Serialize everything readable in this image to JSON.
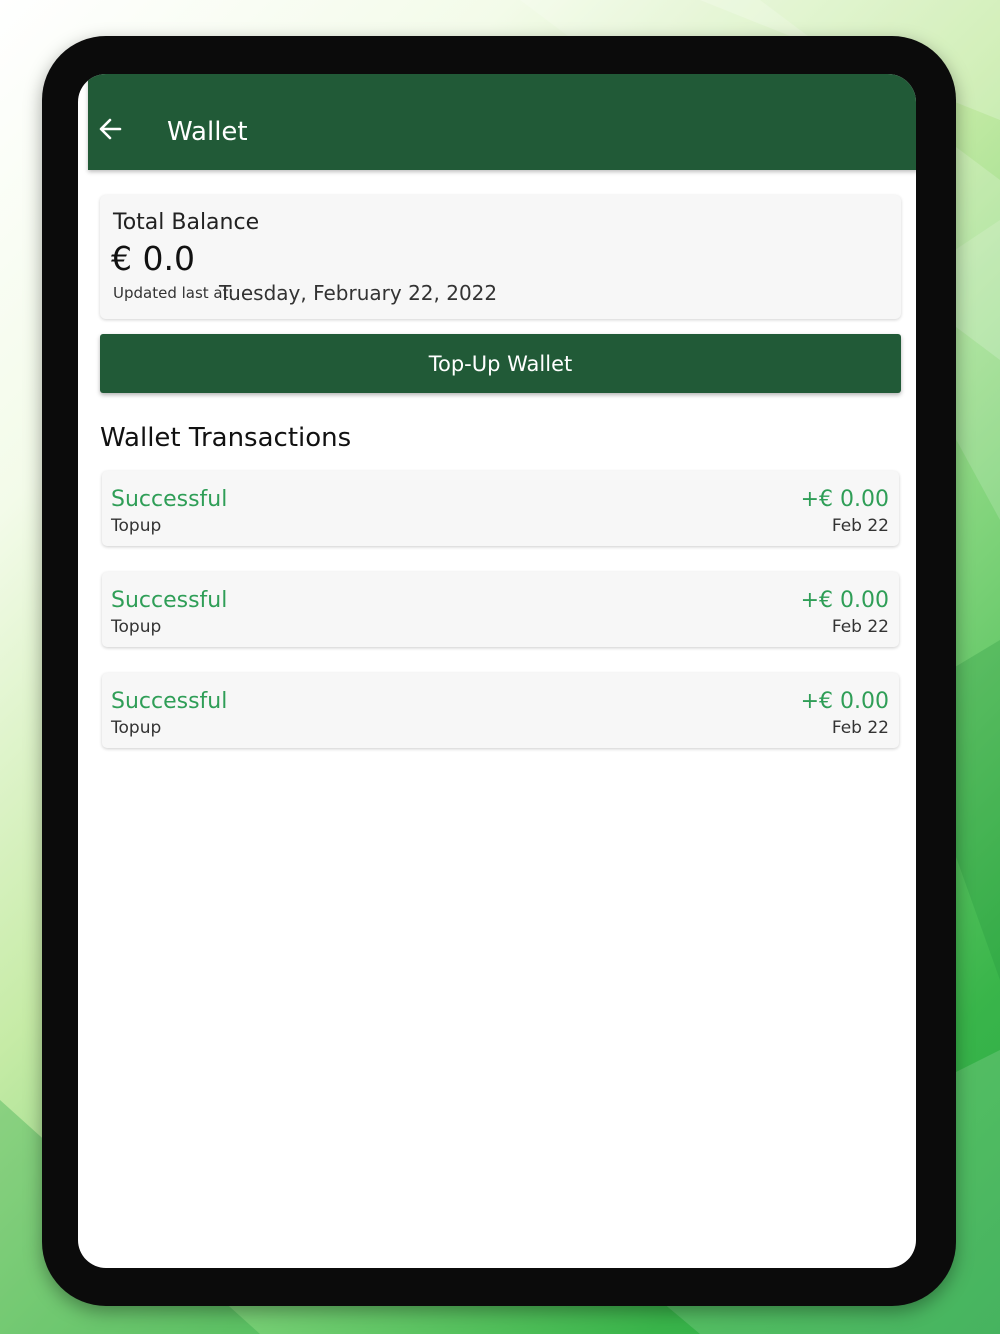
{
  "appbar": {
    "title": "Wallet",
    "back_icon": "arrow-left-icon"
  },
  "balance": {
    "label": "Total Balance",
    "amount": "€ 0.0",
    "updated_label": "Updated last at:",
    "updated_date": "Tuesday, February 22, 2022"
  },
  "topup": {
    "label": "Top-Up Wallet"
  },
  "transactions": {
    "title": "Wallet Transactions",
    "items": [
      {
        "status": "Successful",
        "type": "Topup",
        "amount": "+€ 0.00",
        "date": "Feb 22"
      },
      {
        "status": "Successful",
        "type": "Topup",
        "amount": "+€ 0.00",
        "date": "Feb 22"
      },
      {
        "status": "Successful",
        "type": "Topup",
        "amount": "+€ 0.00",
        "date": "Feb 22"
      }
    ]
  },
  "colors": {
    "primary": "#215a37",
    "success": "#2f9e57",
    "card_bg": "#f7f7f7"
  }
}
